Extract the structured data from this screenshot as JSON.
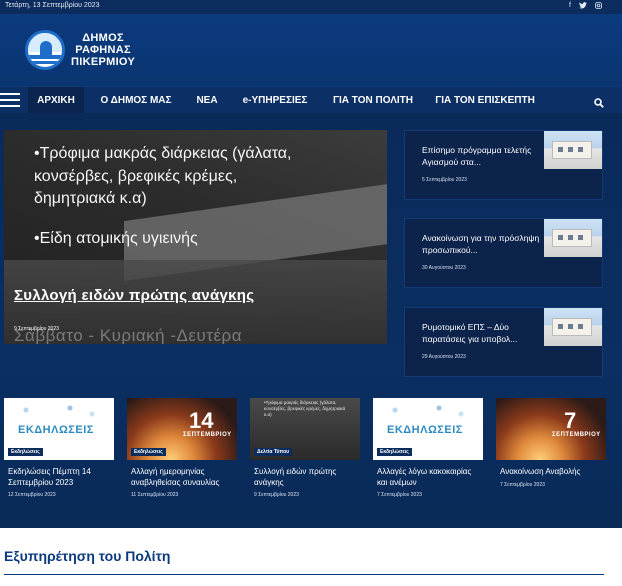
{
  "topbar": {
    "date": "Τετάρτη, 13 Σεπτεμβρίου 2023",
    "social": {
      "facebook": "f",
      "twitter": "🐦",
      "instagram": "◎"
    }
  },
  "logo": {
    "line1": "ΔΗΜΟΣ",
    "line2": "ΡΑΦΗΝΑΣ",
    "line3": "ΠΙΚΕΡΜΙΟΥ"
  },
  "nav": {
    "items": [
      {
        "label": "ΑΡΧΙΚΗ"
      },
      {
        "label": "Ο ΔΗΜΟΣ ΜΑΣ"
      },
      {
        "label": "ΝΕΑ"
      },
      {
        "label": "e-ΥΠΗΡΕΣΙΕΣ"
      },
      {
        "label": "ΓΙΑ ΤΟΝ ΠΟΛΙΤΗ"
      },
      {
        "label": "ΓΙΑ ΤΟΝ ΕΠΙΣΚΕΠΤΗ"
      }
    ],
    "search_icon": "🔍"
  },
  "hero": {
    "overlay_lines": [
      "•Τρόφιμα μακράς διάρκειας (γάλατα,",
      "κονσέρβες, βρεφικές κρέμες,",
      "δημητριακά κ.α)",
      "•Είδη ατομικής υγιεινής"
    ],
    "title": "Συλλογή ειδών πρώτης ανάγκης",
    "date": "9 Σεπτεμβρίου 2023",
    "ghost_text": "Σάββατο - Κυριακή -Δευτέρα"
  },
  "side_cards": [
    {
      "title": "Επίσημο πρόγραμμα τελετής Αγιασμού στα...",
      "date": "5 Σεπτεμβρίου 2023"
    },
    {
      "title": "Ανακοίνωση για την πρόσληψη προσωπικού...",
      "date": "30 Αυγούστου 2023"
    },
    {
      "title": "Ρυμοτομικό ΕΠΣ – Δύο παρατάσεις για υποβολ...",
      "date": "29 Αυγούστου 2023"
    }
  ],
  "cards": [
    {
      "tag": "Εκδηλώσεις",
      "image_text": "ΕΚΔΗΛΩΣΕΙΣ",
      "title": "Εκδηλώσεις Πέμπτη 14 Σεπτεμβρίου 2023",
      "date": "12 Σεπτεμβρίου 2023"
    },
    {
      "tag": "Εκδηλώσεις",
      "image_num": "14",
      "image_word": "ΣΕΠΤΕΜΒΡΙΟΥ",
      "title": "Αλλαγή ημερομηνίας αναβληθείσας συναυλίας",
      "date": "11 Σεπτεμβρίου 2023"
    },
    {
      "tag": "Δελτία Τύπου",
      "image_text": "•Τρόφιμα μακράς διάρκειας (γάλατα, κονσέρβες, βρεφικές κρέμες, δημητριακά κ.α)",
      "title": "Συλλογή ειδών πρώτης ανάγκης",
      "date": "9 Σεπτεμβρίου 2023"
    },
    {
      "tag": "Εκδηλώσεις",
      "image_text": "ΕΚΔΗΛΩΣΕΙΣ",
      "title": "Αλλαγές λόγω κακοκαιρίας και ανέμων",
      "date": "7 Σεπτεμβρίου 2023"
    },
    {
      "tag": "",
      "image_num": "7",
      "image_word": "ΣΕΠΤΕΜΒΡΙΟΥ",
      "title": "Ανακοίνωση Αναβολής",
      "date": "7 Σεπτεμβρίου 2023"
    }
  ],
  "section": {
    "heading": "Εξυπηρέτηση του Πολίτη"
  }
}
